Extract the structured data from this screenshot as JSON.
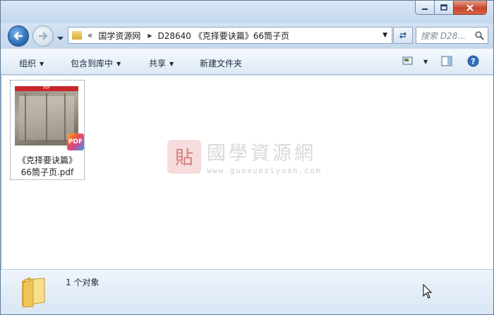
{
  "window": {
    "controls": {
      "minimize_icon": "minimize-icon",
      "maximize_icon": "maximize-icon",
      "close_icon": "close-icon"
    }
  },
  "nav": {
    "back_icon": "arrow-left-icon",
    "forward_icon": "arrow-right-icon",
    "breadcrumb_chevron": "«",
    "breadcrumbs": [
      "国学资源网",
      "D28640 《克择要诀篇》66筒子页"
    ],
    "search_placeholder": "搜索 D28..."
  },
  "toolbar": {
    "organize": "组织",
    "include_in_library": "包含到库中",
    "share": "共享",
    "new_folder": "新建文件夹"
  },
  "file": {
    "name_line1": "《克择要诀篇》",
    "name_line2": "66筒子页.pdf",
    "thumb_strip": "PDF",
    "badge": "PDF"
  },
  "watermark": {
    "title": "國學資源網",
    "url": "www.guoxueziyuan.com",
    "seal": "貼"
  },
  "status": {
    "count_text": "1 个对象"
  },
  "colors": {
    "window_bg": "#c7dbef",
    "close_button": "#c7452b",
    "back_button": "#2c6fb8"
  }
}
